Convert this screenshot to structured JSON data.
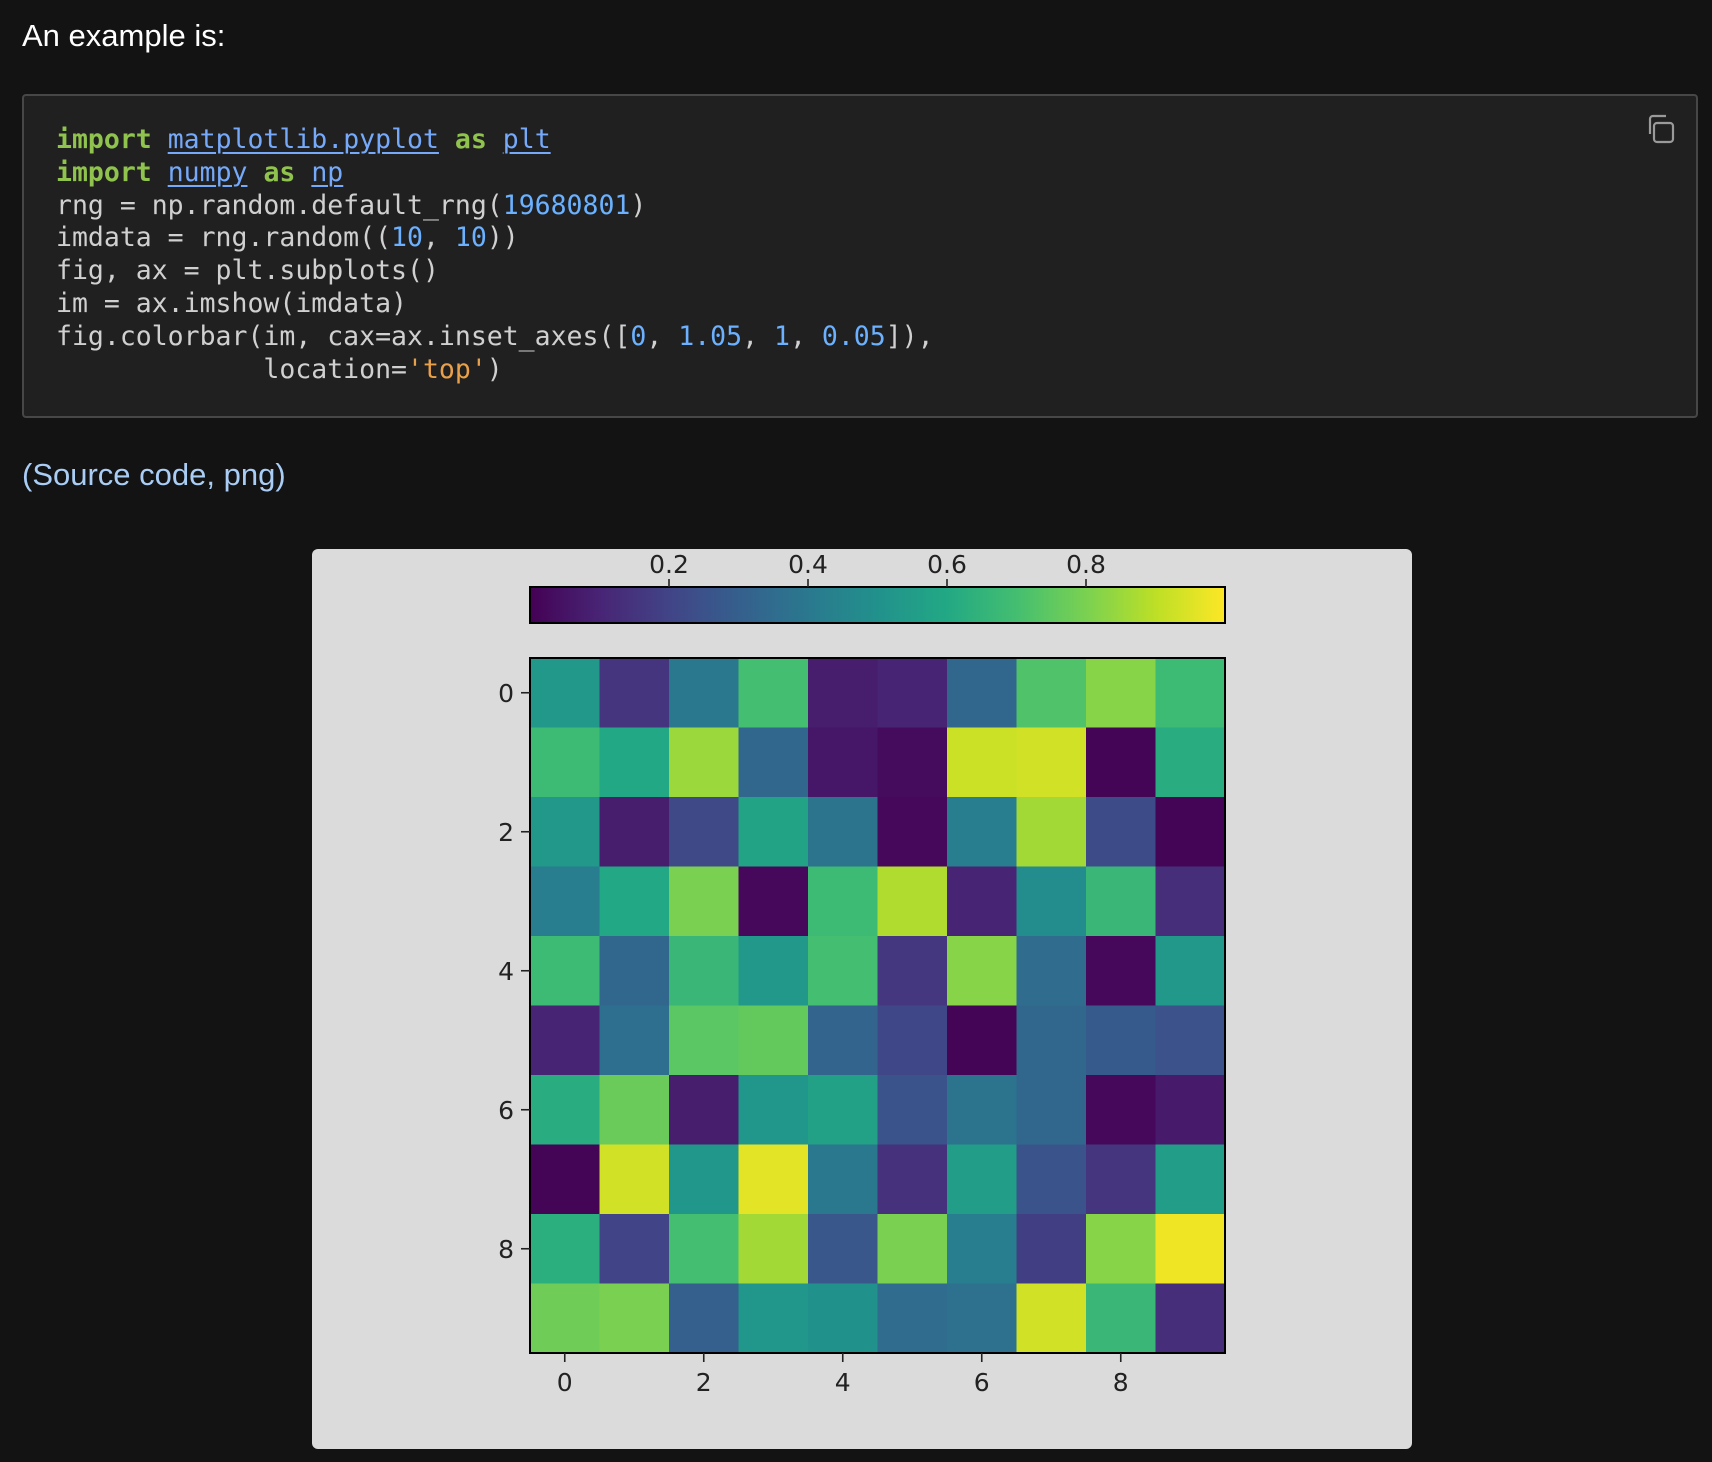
{
  "intro": "An example is:",
  "code": {
    "lines": [
      [
        {
          "t": "import",
          "c": "kw"
        },
        {
          "t": " ",
          "c": ""
        },
        {
          "t": "matplotlib.pyplot",
          "c": "mod"
        },
        {
          "t": " ",
          "c": ""
        },
        {
          "t": "as",
          "c": "kw"
        },
        {
          "t": " ",
          "c": ""
        },
        {
          "t": "plt",
          "c": "mod"
        }
      ],
      [
        {
          "t": "import",
          "c": "kw"
        },
        {
          "t": " ",
          "c": ""
        },
        {
          "t": "numpy",
          "c": "mod"
        },
        {
          "t": " ",
          "c": ""
        },
        {
          "t": "as",
          "c": "kw"
        },
        {
          "t": " ",
          "c": ""
        },
        {
          "t": "np",
          "c": "mod"
        }
      ],
      [
        {
          "t": "rng = np.random.default_rng(",
          "c": ""
        },
        {
          "t": "19680801",
          "c": "num"
        },
        {
          "t": ")",
          "c": ""
        }
      ],
      [
        {
          "t": "imdata = rng.random((",
          "c": ""
        },
        {
          "t": "10",
          "c": "num"
        },
        {
          "t": ", ",
          "c": ""
        },
        {
          "t": "10",
          "c": "num"
        },
        {
          "t": "))",
          "c": ""
        }
      ],
      [
        {
          "t": "fig, ax = plt.subplots()",
          "c": ""
        }
      ],
      [
        {
          "t": "im = ax.imshow(imdata)",
          "c": ""
        }
      ],
      [
        {
          "t": "fig.colorbar(im, cax=ax.inset_axes([",
          "c": ""
        },
        {
          "t": "0",
          "c": "num"
        },
        {
          "t": ", ",
          "c": ""
        },
        {
          "t": "1.05",
          "c": "num"
        },
        {
          "t": ", ",
          "c": ""
        },
        {
          "t": "1",
          "c": "num"
        },
        {
          "t": ", ",
          "c": ""
        },
        {
          "t": "0.05",
          "c": "num"
        },
        {
          "t": "]),",
          "c": ""
        }
      ],
      [
        {
          "t": "             location=",
          "c": ""
        },
        {
          "t": "'top'",
          "c": "str"
        },
        {
          "t": ")",
          "c": ""
        }
      ]
    ],
    "copy_icon": "copy-icon"
  },
  "links": {
    "open_paren": "(",
    "source_code": "Source code",
    "separator": ", ",
    "png": "png",
    "close_paren": ")"
  },
  "chart_data": {
    "type": "heatmap",
    "colormap": "viridis",
    "rows": [
      [
        0.53,
        0.15,
        0.4,
        0.7,
        0.08,
        0.1,
        0.33,
        0.72,
        0.82,
        0.68
      ],
      [
        0.68,
        0.6,
        0.85,
        0.33,
        0.06,
        0.03,
        0.92,
        0.93,
        0.01,
        0.62
      ],
      [
        0.53,
        0.08,
        0.22,
        0.58,
        0.38,
        0.02,
        0.42,
        0.86,
        0.23,
        0.01
      ],
      [
        0.42,
        0.6,
        0.8,
        0.02,
        0.68,
        0.88,
        0.1,
        0.48,
        0.67,
        0.13
      ],
      [
        0.68,
        0.33,
        0.67,
        0.53,
        0.7,
        0.16,
        0.82,
        0.35,
        0.02,
        0.53
      ],
      [
        0.1,
        0.36,
        0.74,
        0.76,
        0.32,
        0.21,
        0.01,
        0.33,
        0.28,
        0.25
      ],
      [
        0.62,
        0.77,
        0.08,
        0.52,
        0.57,
        0.26,
        0.38,
        0.33,
        0.02,
        0.07
      ],
      [
        0.01,
        0.93,
        0.52,
        0.96,
        0.4,
        0.14,
        0.55,
        0.26,
        0.15,
        0.55
      ],
      [
        0.63,
        0.2,
        0.7,
        0.86,
        0.27,
        0.8,
        0.42,
        0.18,
        0.82,
        0.98
      ],
      [
        0.78,
        0.8,
        0.3,
        0.52,
        0.5,
        0.35,
        0.37,
        0.93,
        0.67,
        0.13
      ]
    ],
    "x_ticks": [
      "0",
      "2",
      "4",
      "6",
      "8"
    ],
    "y_ticks": [
      "0",
      "2",
      "4",
      "6",
      "8"
    ],
    "colorbar": {
      "location": "top",
      "range": [
        0,
        1
      ],
      "ticks": [
        "0.2",
        "0.4",
        "0.6",
        "0.8"
      ]
    }
  }
}
